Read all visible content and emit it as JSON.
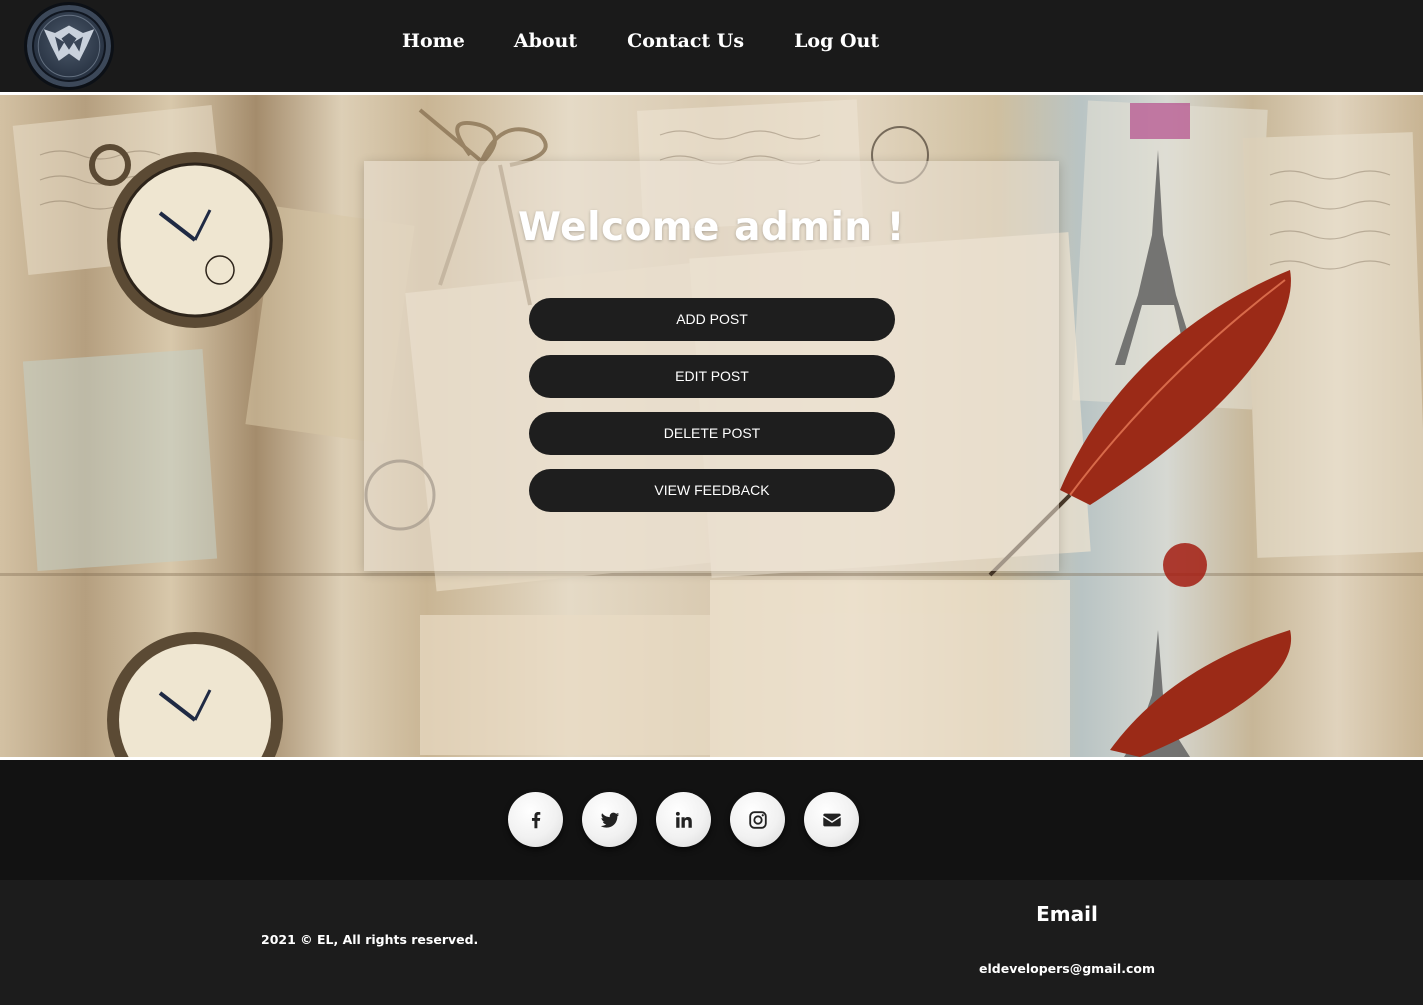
{
  "header": {
    "logo_icon": "shield-eagle-logo",
    "nav": {
      "home": "Home",
      "about": "About",
      "contact": "Contact Us",
      "logout": "Log Out"
    }
  },
  "hero": {
    "welcome": "Welcome admin !",
    "actions": {
      "add_post": "ADD POST",
      "edit_post": "EDIT POST",
      "delete_post": "DELETE POST",
      "view_feedback": "VIEW FEEDBACK"
    }
  },
  "social": {
    "icons": [
      "facebook-icon",
      "twitter-icon",
      "linkedin-icon",
      "instagram-icon",
      "envelope-icon"
    ]
  },
  "footer": {
    "copyright": "2021 © EL, All rights reserved.",
    "email_heading": "Email",
    "email_address": "eldevelopers@gmail.com"
  },
  "colors": {
    "header_bg": "#1a1a1a",
    "button_bg": "#1e1e1e",
    "social_bar_bg": "#121212",
    "footer_bg": "#1c1c1c",
    "text_light": "#ffffff"
  }
}
